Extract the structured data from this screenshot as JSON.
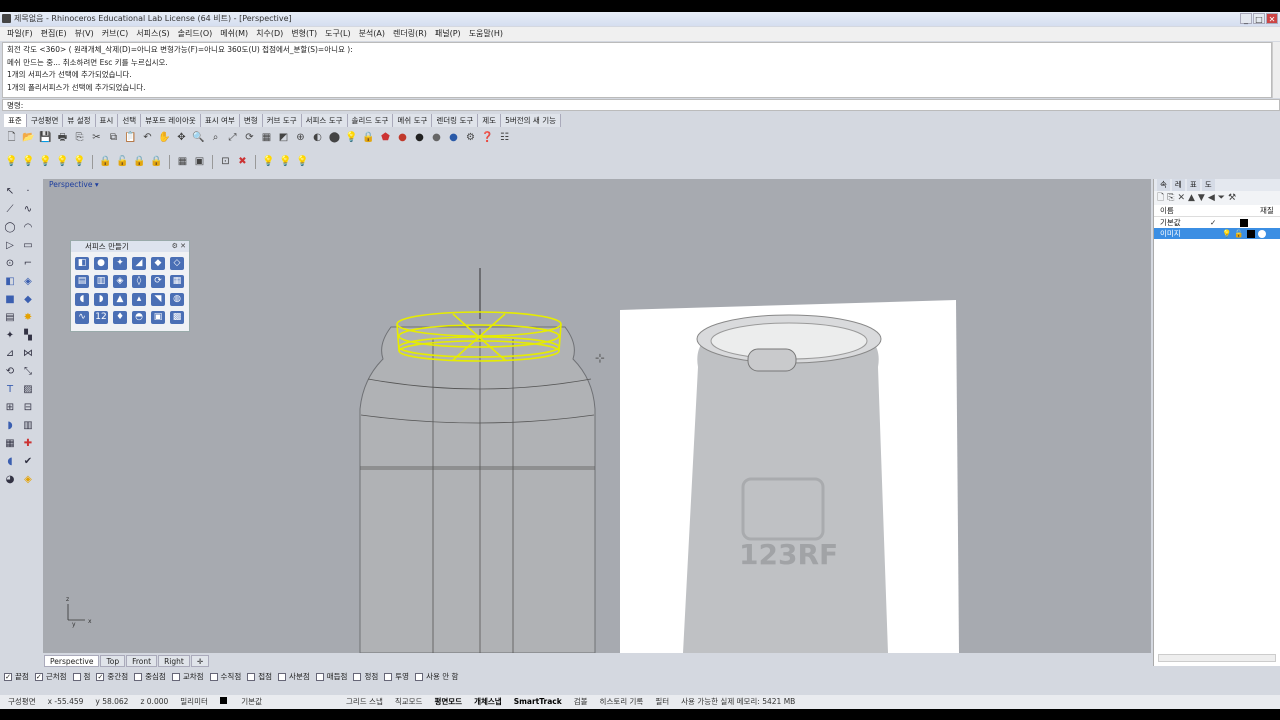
{
  "window": {
    "title": "제목없음 - Rhinoceros Educational Lab License (64 비트) - [Perspective]",
    "buttons": [
      "_",
      "□",
      "✕"
    ]
  },
  "menu": [
    "파일(F)",
    "편집(E)",
    "뷰(V)",
    "커브(C)",
    "서피스(S)",
    "솔리드(O)",
    "메쉬(M)",
    "치수(D)",
    "변형(T)",
    "도구(L)",
    "분석(A)",
    "렌더링(R)",
    "패널(P)",
    "도움말(H)"
  ],
  "command_history": [
    "회전 각도 <360> ( 원래개체_삭제(D)=아니요  변형가능(F)=아니요  360도(U)  접점에서_분할(S)=아니요 ):",
    "메쉬 만드는 중... 취소하려면 Esc 키를 누르십시오.",
    "1개의 서피스가 선택에 추가되었습니다.",
    "1개의 폴리서피스가 선택에 추가되었습니다."
  ],
  "command_prompt": "명령:",
  "toolbar_tabs": [
    "표준",
    "구성평면",
    "뷰 설정",
    "표시",
    "선택",
    "뷰포트 레이아웃",
    "표시 여부",
    "변형",
    "커브 도구",
    "서피스 도구",
    "솔리드 도구",
    "메쉬 도구",
    "렌더링 도구",
    "제도",
    "5버전의 새 기능"
  ],
  "active_toolbar_tab": "표준",
  "toolbar_icons_row1": [
    "new-icon",
    "open-icon",
    "save-icon",
    "print-icon",
    "import-icon",
    "cut-icon",
    "copy-icon",
    "paste-icon",
    "undo-icon",
    "pan-icon",
    "move-icon",
    "zoom-window-icon",
    "zoom-dynamic-icon",
    "zoom-extents-icon",
    "rotate-view-icon",
    "grid-icon",
    "cplane-icon",
    "snap-icon",
    "shade-icon",
    "render-icon",
    "light-icon",
    "lock-icon",
    "color-icon",
    "material-icon",
    "sphere-icon",
    "render-preview-icon",
    "settings-icon",
    "options-icon",
    "help-icon",
    "extra-icon"
  ],
  "toolbar_icons_row2": [
    "bulb-icon",
    "bulb-on-icon",
    "bulb-off-icon",
    "bulb-select-icon",
    "bulb-multi-icon",
    "lock-icon",
    "unlock-icon",
    "lock-select-icon",
    "lock-multi-icon",
    "grid-select-icon",
    "group-icon",
    "ungroup-icon",
    "block-icon",
    "delete-icon",
    "bulb-show-icon",
    "bulb-hide-icon",
    "bulb-swap-icon"
  ],
  "viewport": {
    "name": "Perspective",
    "axis_labels": {
      "z": "z",
      "y": "y",
      "x": "x"
    }
  },
  "surface_panel": {
    "title": "서피스 만들기",
    "icon_count": 24
  },
  "image_watermark": "123RF",
  "right_panel": {
    "tabs": [
      "속",
      "레",
      "표",
      "도"
    ],
    "header": {
      "name": "이름",
      "material": "재질"
    },
    "layers": [
      {
        "name": "기본값",
        "check": "✓",
        "selected": false
      },
      {
        "name": "이미지",
        "check": "",
        "selected": true
      }
    ]
  },
  "view_tabs": [
    "Perspective",
    "Top",
    "Front",
    "Right"
  ],
  "active_view_tab": "Perspective",
  "osnaps": [
    {
      "label": "끝점",
      "checked": true
    },
    {
      "label": "근처점",
      "checked": true
    },
    {
      "label": "점",
      "checked": false
    },
    {
      "label": "중간점",
      "checked": true
    },
    {
      "label": "중심점",
      "checked": false
    },
    {
      "label": "교차점",
      "checked": false
    },
    {
      "label": "수직점",
      "checked": false
    },
    {
      "label": "접점",
      "checked": false
    },
    {
      "label": "사분점",
      "checked": false
    },
    {
      "label": "매듭점",
      "checked": false
    },
    {
      "label": "정점",
      "checked": false
    },
    {
      "label": "투영",
      "checked": false
    },
    {
      "label": "사용 안 함",
      "checked": false
    }
  ],
  "status": {
    "cplane": "구성평면",
    "x": "x -55.459",
    "y": "y 58.062",
    "z": "z 0.000",
    "units": "밀리미터",
    "layer": "기본값",
    "grid_snap": "그리드 스냅",
    "ortho": "직교모드",
    "planar": "평면모드",
    "osnap": "개체스냅",
    "smarttrack": "SmartTrack",
    "gumball": "검볼",
    "history": "히스토리 기록",
    "filter": "필터",
    "memory": "사용 가능한 실제 메모리: 5421 MB"
  }
}
